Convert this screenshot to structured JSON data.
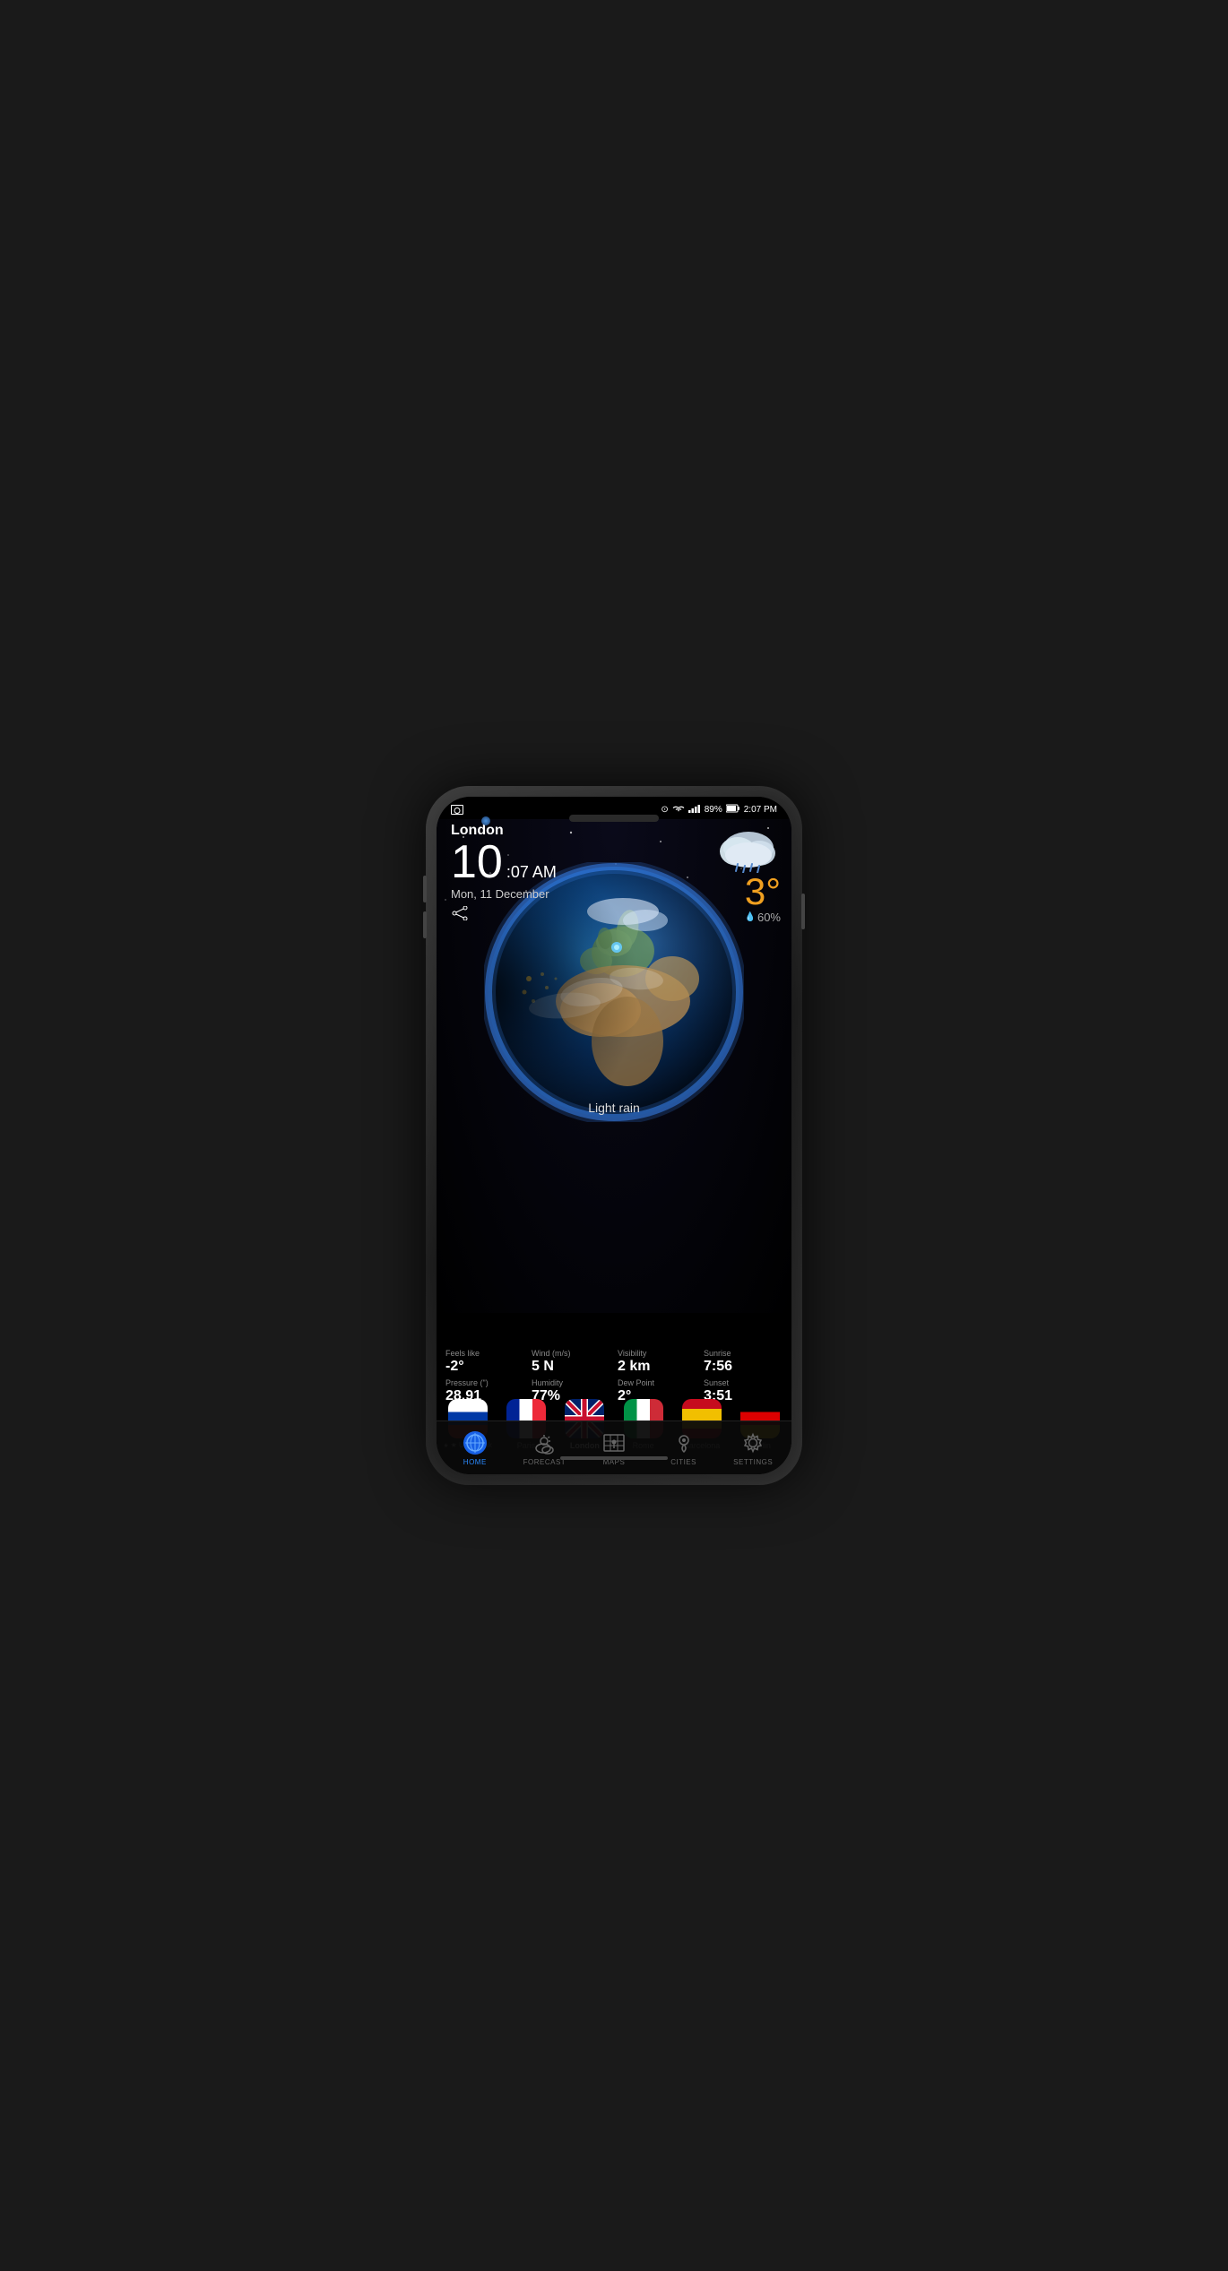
{
  "phone": {
    "status_bar": {
      "left_icon": "photo",
      "location_icon": "📍",
      "wifi_icon": "wifi",
      "signal_icon": "signal",
      "battery": "89%",
      "time": "2:07 PM"
    },
    "city_header": {
      "city_name": "London",
      "time_big": "10",
      "time_suffix": ":07 AM",
      "date": "Mon, 11 December",
      "share_icon": "share"
    },
    "weather_top_right": {
      "temperature": "3°",
      "rain_percent": "60%",
      "condition_icon": "cloud-rain"
    },
    "globe": {
      "condition_label": "Light rain"
    },
    "weather_details": [
      {
        "label": "Feels like",
        "value": "-2°"
      },
      {
        "label": "Wind (m/s)",
        "value": "5 N"
      },
      {
        "label": "Visibility",
        "value": "2 km"
      },
      {
        "label": "Sunrise",
        "value": "7:56"
      },
      {
        "label": "Pressure (\")",
        "value": "28.91"
      },
      {
        "label": "Humidity",
        "value": "77%"
      },
      {
        "label": "Dew Point",
        "value": "2°"
      },
      {
        "label": "Sunset",
        "value": "3:51"
      }
    ],
    "cities": [
      {
        "id": "ulyanovsk",
        "label": "★ Ulyanovsk",
        "flag": "russia",
        "active": false,
        "star": true
      },
      {
        "id": "paris",
        "label": "Paris",
        "flag": "france",
        "active": false,
        "star": false
      },
      {
        "id": "london",
        "label": "London",
        "flag": "uk",
        "active": true,
        "star": false
      },
      {
        "id": "rome",
        "label": "Rome",
        "flag": "italy",
        "active": false,
        "star": false
      },
      {
        "id": "barcelona",
        "label": "Barcelona",
        "flag": "spain",
        "active": false,
        "star": false
      },
      {
        "id": "berlin",
        "label": "Berlin",
        "flag": "germany",
        "active": false,
        "star": false
      }
    ],
    "nav_items": [
      {
        "id": "home",
        "label": "HOME",
        "icon": "globe-blue",
        "active": true
      },
      {
        "id": "forecast",
        "label": "FORECAST",
        "icon": "sun-cloud",
        "active": false
      },
      {
        "id": "maps",
        "label": "MAPS",
        "icon": "map",
        "active": false
      },
      {
        "id": "cities",
        "label": "CITIES",
        "icon": "location-pin",
        "active": false
      },
      {
        "id": "settings",
        "label": "SETTINGS",
        "icon": "gear",
        "active": false
      }
    ]
  }
}
